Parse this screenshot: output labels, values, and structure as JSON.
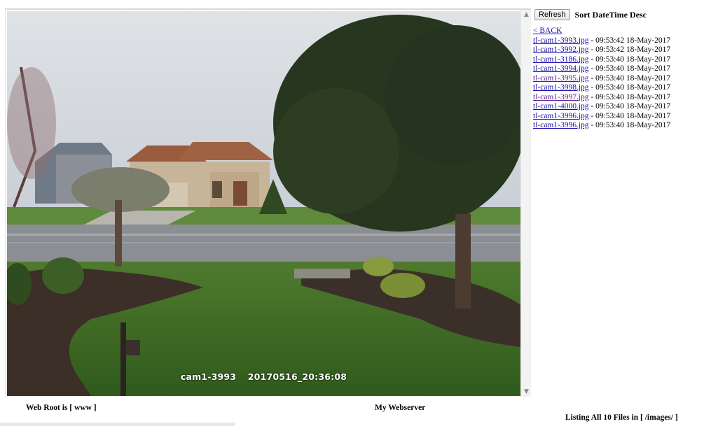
{
  "viewer": {
    "camera_label": "cam1-3993",
    "timestamp_label": "20170516_20:36:08",
    "scroll_up_icon": "triangle-up",
    "scroll_down_icon": "triangle-down"
  },
  "toolbar": {
    "refresh_label": "Refresh",
    "sort_label": "Sort DateTime Desc"
  },
  "file_list": {
    "back_label": "< BACK",
    "files": [
      {
        "name": "tl-cam1-3993.jpg",
        "meta": " - 09:53:42 18-May-2017"
      },
      {
        "name": "tl-cam1-3992.jpg",
        "meta": " - 09:53:42 18-May-2017"
      },
      {
        "name": "tl-cam1-3186.jpg",
        "meta": " - 09:53:40 18-May-2017"
      },
      {
        "name": "tl-cam1-3994.jpg",
        "meta": " - 09:53:40 18-May-2017"
      },
      {
        "name": "tl-cam1-3995.jpg",
        "meta": " - 09:53:40 18-May-2017"
      },
      {
        "name": "tl-cam1-3998.jpg",
        "meta": " - 09:53:40 18-May-2017"
      },
      {
        "name": "tl-cam1-3997.jpg",
        "meta": " - 09:53:40 18-May-2017"
      },
      {
        "name": "tl-cam1-4000.jpg",
        "meta": " - 09:53:40 18-May-2017"
      },
      {
        "name": "tl-cam1-3996.jpg",
        "meta": " - 09:53:40 18-May-2017"
      },
      {
        "name": "tl-cam1-3996.jpg",
        "meta": " - 09:53:40 18-May-2017"
      }
    ]
  },
  "footer": {
    "web_root": "Web Root is [ www ]",
    "server_name": "My Webserver",
    "listing": "Listing All 10 Files in [ /images/ ]"
  },
  "colors": {
    "link": "#1a0dab",
    "visited_link": "#551a8b"
  }
}
